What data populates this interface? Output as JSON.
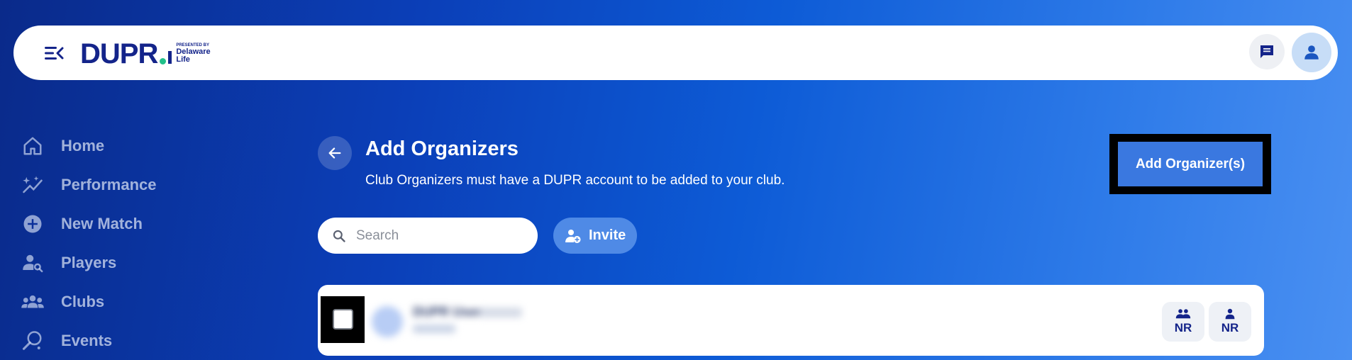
{
  "header": {
    "logo": {
      "text": "DUPR",
      "presented_by": "PRESENTED BY",
      "sponsor_line1": "Delaware",
      "sponsor_line2": "Life"
    },
    "menu_icon": "menu-collapse-icon",
    "chat_icon": "chat-icon",
    "profile_icon": "user-icon"
  },
  "sidebar": {
    "items": [
      {
        "label": "Home",
        "icon": "home-icon"
      },
      {
        "label": "Performance",
        "icon": "performance-icon"
      },
      {
        "label": "New Match",
        "icon": "plus-circle-icon"
      },
      {
        "label": "Players",
        "icon": "player-search-icon"
      },
      {
        "label": "Clubs",
        "icon": "group-icon"
      },
      {
        "label": "Events",
        "icon": "events-icon"
      }
    ]
  },
  "main": {
    "title": "Add Organizers",
    "subtitle": "Club Organizers must have a DUPR account to be added to your club.",
    "add_button_label": "Add Organizer(s)",
    "search": {
      "placeholder": "Search",
      "value": ""
    },
    "invite_label": "Invite",
    "rows": [
      {
        "name": "DUPR User",
        "doubles_rating": "NR",
        "singles_rating": "NR"
      }
    ]
  },
  "colors": {
    "brand_navy": "#14248a",
    "brand_green": "#22c08a",
    "button_blue": "#3a78e0"
  }
}
